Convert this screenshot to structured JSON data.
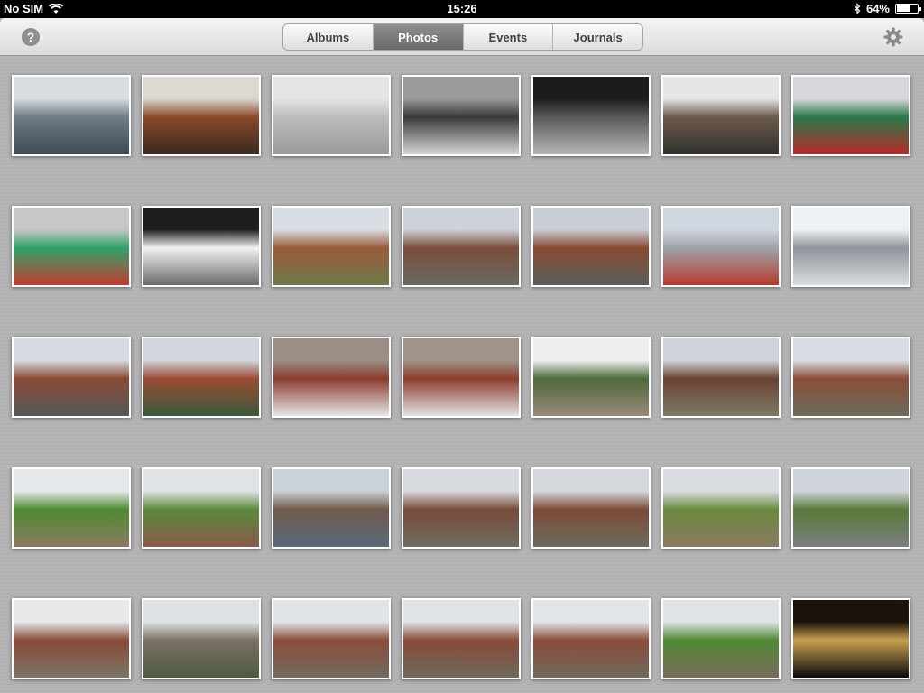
{
  "statusbar": {
    "carrier": "No SIM",
    "time": "15:26",
    "battery_percent": "64%",
    "battery_level": 0.64
  },
  "toolbar": {
    "help_label": "?",
    "segments": [
      {
        "label": "Albums",
        "selected": false
      },
      {
        "label": "Photos",
        "selected": true
      },
      {
        "label": "Events",
        "selected": false
      },
      {
        "label": "Journals",
        "selected": false
      }
    ]
  },
  "photos": [
    {
      "scene": "library-shelves",
      "colors": [
        "#d8dde0",
        "#6f7b86",
        "#3d4b55"
      ]
    },
    {
      "scene": "room-cabinet",
      "colors": [
        "#dcd8d2",
        "#8a4a2a",
        "#3a2a20"
      ]
    },
    {
      "scene": "window-wall",
      "colors": [
        "#e4e4e4",
        "#bdbdbd",
        "#9a9a9a"
      ]
    },
    {
      "scene": "perforated-panel",
      "colors": [
        "#9a9a9a",
        "#3a3a3a",
        "#d5d5d5"
      ]
    },
    {
      "scene": "perforated-panel-dark",
      "colors": [
        "#1c1c1c",
        "#5a5a5a",
        "#b5b5b5"
      ]
    },
    {
      "scene": "office-overhead",
      "colors": [
        "#e6e6e6",
        "#6d5a4a",
        "#30302e"
      ]
    },
    {
      "scene": "green-boxes-room",
      "colors": [
        "#d8d8dc",
        "#2a7a4a",
        "#b52a2a"
      ]
    },
    {
      "scene": "green-crates",
      "colors": [
        "#c9c6c8",
        "#2fa36a",
        "#c43a32"
      ]
    },
    {
      "scene": "skylight-roof",
      "colors": [
        "#1e1e1e",
        "#f2f2f2",
        "#6a6a6a"
      ]
    },
    {
      "scene": "town-rooftops",
      "colors": [
        "#d9dde4",
        "#9a5a3a",
        "#6e7a4a"
      ]
    },
    {
      "scene": "docks-overview",
      "colors": [
        "#cdd2d8",
        "#7a4d3a",
        "#6a6a62"
      ]
    },
    {
      "scene": "docks-street",
      "colors": [
        "#c9ced6",
        "#8a4a32",
        "#5b5f5a"
      ]
    },
    {
      "scene": "car-park",
      "colors": [
        "#cfd6df",
        "#9ea3a7",
        "#b63a2e"
      ]
    },
    {
      "scene": "building-facade",
      "colors": [
        "#eef1f4",
        "#8f959b",
        "#d8dcdf"
      ]
    },
    {
      "scene": "warehouses",
      "colors": [
        "#d6dbe1",
        "#8a4a36",
        "#54585a"
      ]
    },
    {
      "scene": "brick-warehouse",
      "colors": [
        "#d1d6dc",
        "#9a4a34",
        "#3a5a3a"
      ]
    },
    {
      "scene": "dock-boat",
      "colors": [
        "#9b8e84",
        "#8a3c2e",
        "#e6e6e6"
      ]
    },
    {
      "scene": "dock-boat-2",
      "colors": [
        "#a09388",
        "#8e3e2f",
        "#e2e2e2"
      ]
    },
    {
      "scene": "green-hills",
      "colors": [
        "#eeeeee",
        "#4e6a3a",
        "#9a8a7a"
      ]
    },
    {
      "scene": "canal-warehouse",
      "colors": [
        "#cfd4da",
        "#6a4232",
        "#7f7a66"
      ]
    },
    {
      "scene": "canal-basin",
      "colors": [
        "#d8dde3",
        "#8a4e3a",
        "#6e6a5a"
      ]
    },
    {
      "scene": "farmhouse-field",
      "colors": [
        "#e5e8ea",
        "#4f8a33",
        "#8b7a62"
      ]
    },
    {
      "scene": "field-path",
      "colors": [
        "#dfe3e6",
        "#5a8a3a",
        "#8a5a4a"
      ]
    },
    {
      "scene": "canal-boats",
      "colors": [
        "#cbd1d8",
        "#6f5a4a",
        "#5a6a7a"
      ]
    },
    {
      "scene": "canal-barge",
      "colors": [
        "#d6dade",
        "#7a4a3a",
        "#6d6d5f"
      ]
    },
    {
      "scene": "canal-bend",
      "colors": [
        "#d4d8dc",
        "#7e4a38",
        "#6c6b5c"
      ]
    },
    {
      "scene": "rail-green",
      "colors": [
        "#d9dde1",
        "#6b8a3e",
        "#8a7a62"
      ]
    },
    {
      "scene": "river-cranes",
      "colors": [
        "#cfd5db",
        "#5a7a3a",
        "#7a7e80"
      ]
    },
    {
      "scene": "swing-bridge",
      "colors": [
        "#e6e8ea",
        "#8a4a38",
        "#7b7565"
      ]
    },
    {
      "scene": "river-boat",
      "colors": [
        "#dfe2e5",
        "#7a7164",
        "#4e5a3e"
      ]
    },
    {
      "scene": "canal-locks",
      "colors": [
        "#e1e4e6",
        "#8c4c3a",
        "#716b5e"
      ]
    },
    {
      "scene": "canal-locks-2",
      "colors": [
        "#e0e3e6",
        "#8a4a38",
        "#6e695c"
      ]
    },
    {
      "scene": "swing-bridge-2",
      "colors": [
        "#e3e6e8",
        "#8c4c3b",
        "#6f6a5c"
      ]
    },
    {
      "scene": "town-park",
      "colors": [
        "#dfe3e6",
        "#4f8a34",
        "#7a6a5a"
      ]
    },
    {
      "scene": "night-river",
      "colors": [
        "#1a140c",
        "#c9a050",
        "#0a0a0a"
      ]
    }
  ]
}
